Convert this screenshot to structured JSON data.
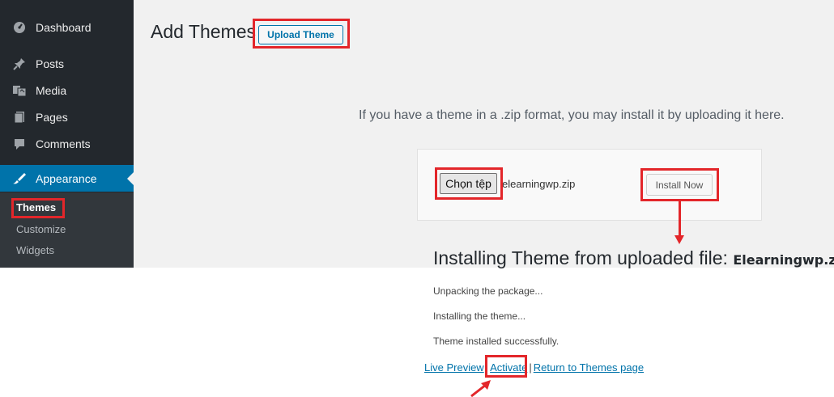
{
  "sidebar": {
    "items": [
      {
        "label": "Dashboard",
        "icon": "dashboard-icon"
      },
      {
        "label": "Posts",
        "icon": "pin-icon"
      },
      {
        "label": "Media",
        "icon": "media-icon"
      },
      {
        "label": "Pages",
        "icon": "pages-icon"
      },
      {
        "label": "Comments",
        "icon": "comments-icon"
      },
      {
        "label": "Appearance",
        "icon": "brush-icon"
      }
    ],
    "submenu": [
      "Themes",
      "Customize",
      "Widgets"
    ]
  },
  "header": {
    "title": "Add Themes",
    "upload_label": "Upload Theme"
  },
  "upload": {
    "hint": "If you have a theme in a .zip format, you may install it by uploading it here.",
    "choose_label": "Chọn tệp",
    "file_name": "elearningwp.zip",
    "install_label": "Install Now"
  },
  "result": {
    "title": "Installing Theme from uploaded file:",
    "file": "Elearningwp.zip",
    "steps": [
      "Unpacking the package...",
      "Installing the theme...",
      "Theme installed successfully."
    ],
    "links": {
      "live_preview": "Live Preview",
      "separator": "|",
      "activate": "Activate",
      "return": "Return to Themes page"
    }
  },
  "colors": {
    "sidebar_bg": "#23282d",
    "accent": "#0073aa",
    "annotation": "#e3262a"
  }
}
